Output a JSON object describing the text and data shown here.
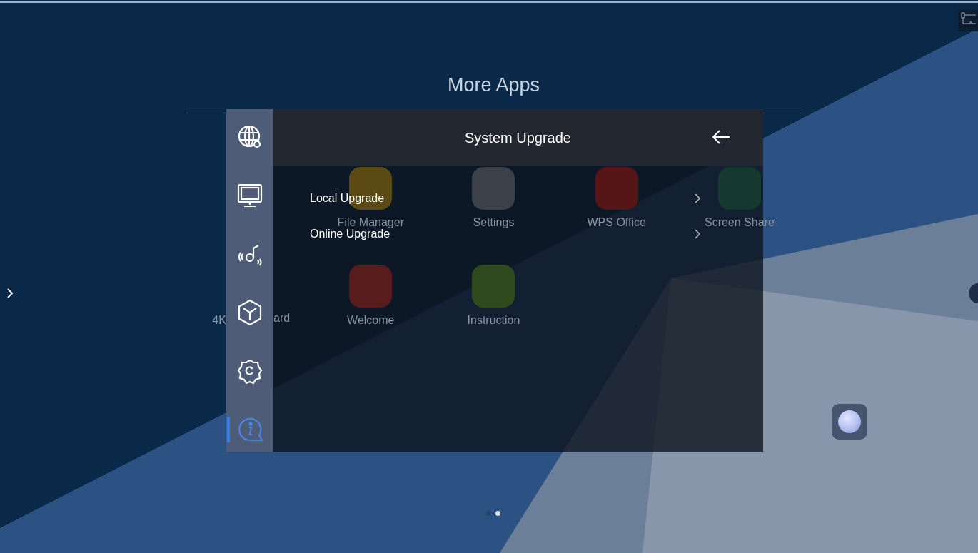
{
  "launcher": {
    "title": "More Apps",
    "app_rows": [
      {
        "apps": [
          {
            "label": "File Manager",
            "color": "#5b4a14"
          },
          {
            "label": "Settings",
            "color": "#3b4049"
          },
          {
            "label": "WPS Office",
            "color": "#561618"
          },
          {
            "label": "Screen Share",
            "color": "#15392f"
          }
        ]
      },
      {
        "apps": [
          {
            "label": "4K",
            "label_tail": "ard"
          },
          {
            "label": "Welcome",
            "color": "#581c1c"
          },
          {
            "label": "Instruction",
            "color": "#2f4a1c"
          }
        ]
      }
    ],
    "pages": [
      {
        "selected": false
      },
      {
        "selected": true
      }
    ]
  },
  "settings_panel": {
    "title": "System Upgrade",
    "sidebar": {
      "items": [
        {
          "selected": false
        },
        {
          "selected": false
        },
        {
          "selected": false
        },
        {
          "selected": false
        },
        {
          "selected": false
        },
        {
          "selected": true
        }
      ]
    },
    "options": [
      {
        "label": "Local Upgrade"
      },
      {
        "label": "Online Upgrade"
      }
    ]
  }
}
